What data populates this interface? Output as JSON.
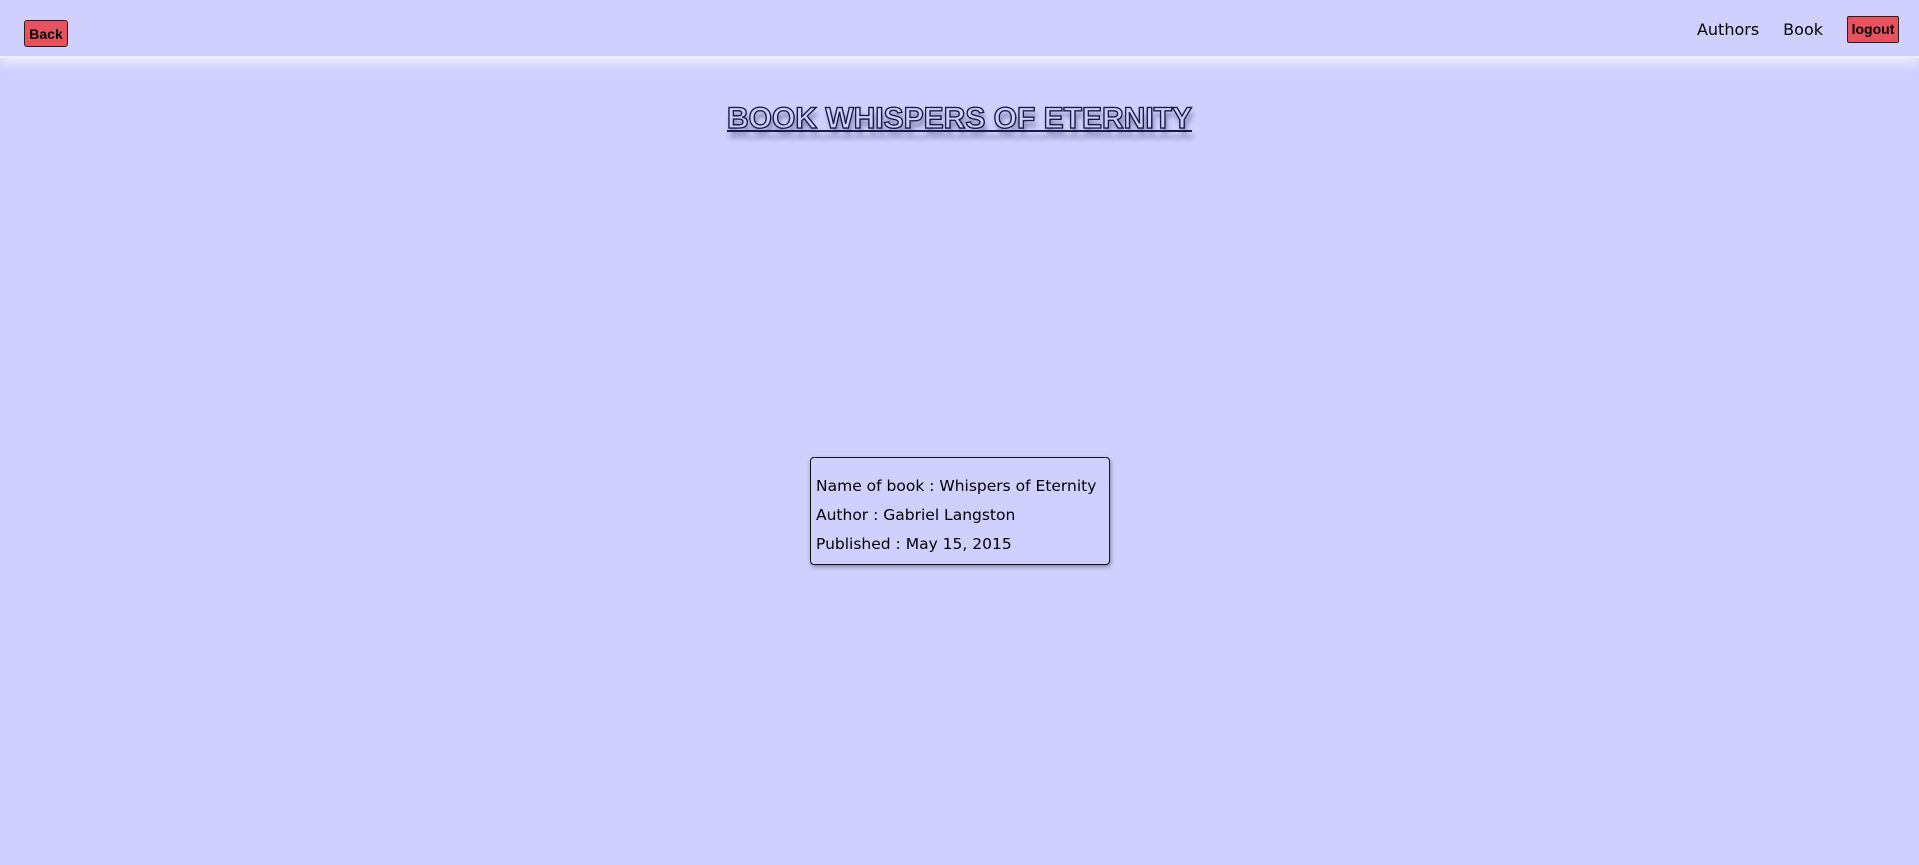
{
  "header": {
    "back_label": "Back",
    "nav": {
      "authors_label": "Authors",
      "book_label": "Book",
      "logout_label": "logout"
    }
  },
  "page": {
    "title": "BOOK WHISPERS OF ETERNITY"
  },
  "book": {
    "name_line": "Name of book : Whispers of Eternity",
    "author_line": "Author : Gabriel Langston",
    "published_line": "Published : May 15, 2015"
  },
  "colors": {
    "background": "#cfd0fe",
    "button": "#e8525f"
  }
}
